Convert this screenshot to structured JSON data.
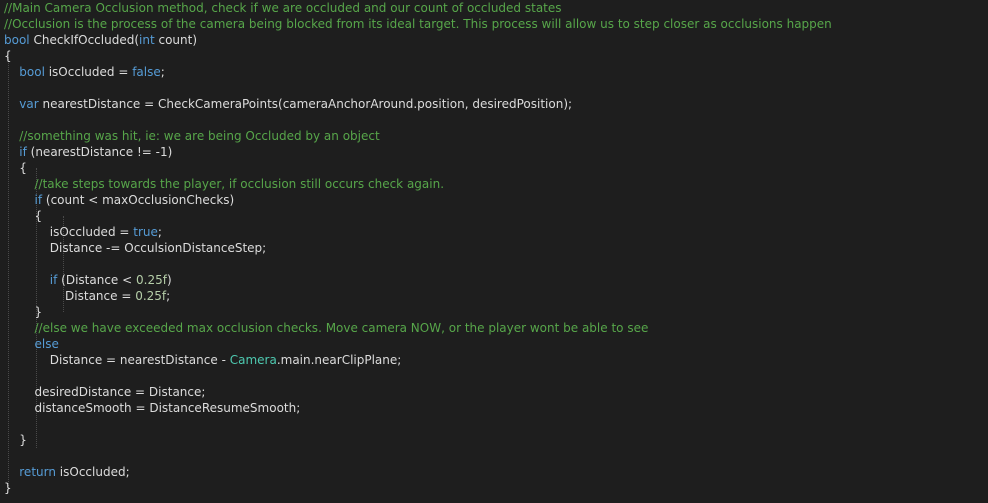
{
  "editor": {
    "language": "csharp",
    "colors": {
      "background": "#1e1e1e",
      "keyword": "#569cd6",
      "comment": "#57a64a",
      "number": "#b5cea8",
      "type": "#4ec9b0",
      "text": "#dcdcdc"
    },
    "lines": [
      [
        [
          "cm",
          "//Main Camera Occlusion method, check if we are occluded and our count of occluded states"
        ]
      ],
      [
        [
          "cm",
          "//Occlusion is the process of the camera being blocked from its ideal target. This process will allow us to step closer as occlusions happen"
        ]
      ],
      [
        [
          "kw",
          "bool"
        ],
        [
          "tx",
          " CheckIfOccluded("
        ],
        [
          "kw",
          "int"
        ],
        [
          "tx",
          " count)"
        ]
      ],
      [
        [
          "tx",
          "{"
        ]
      ],
      [
        [
          "tx",
          "    "
        ],
        [
          "kw",
          "bool"
        ],
        [
          "tx",
          " isOccluded = "
        ],
        [
          "kw",
          "false"
        ],
        [
          "tx",
          ";"
        ]
      ],
      [
        [
          "tx",
          ""
        ]
      ],
      [
        [
          "tx",
          "    "
        ],
        [
          "kw",
          "var"
        ],
        [
          "tx",
          " nearestDistance = CheckCameraPoints(cameraAnchorAround.position, desiredPosition);"
        ]
      ],
      [
        [
          "tx",
          ""
        ]
      ],
      [
        [
          "tx",
          "    "
        ],
        [
          "cm",
          "//something was hit, ie: we are being Occluded by an object"
        ]
      ],
      [
        [
          "tx",
          "    "
        ],
        [
          "kw",
          "if"
        ],
        [
          "tx",
          " (nearestDistance != -1)"
        ]
      ],
      [
        [
          "tx",
          "    {"
        ]
      ],
      [
        [
          "tx",
          "        "
        ],
        [
          "cm",
          "//take steps towards the player, if occlusion still occurs check again."
        ]
      ],
      [
        [
          "tx",
          "        "
        ],
        [
          "kw",
          "if"
        ],
        [
          "tx",
          " (count < maxOcclusionChecks)"
        ]
      ],
      [
        [
          "tx",
          "        {"
        ]
      ],
      [
        [
          "tx",
          "            isOccluded = "
        ],
        [
          "kw",
          "true"
        ],
        [
          "tx",
          ";"
        ]
      ],
      [
        [
          "tx",
          "            Distance -= OcculsionDistanceStep;"
        ]
      ],
      [
        [
          "tx",
          ""
        ]
      ],
      [
        [
          "tx",
          "            "
        ],
        [
          "kw",
          "if"
        ],
        [
          "tx",
          " (Distance < "
        ],
        [
          "nm",
          "0.25f"
        ],
        [
          "tx",
          ")"
        ]
      ],
      [
        [
          "tx",
          "                Distance = "
        ],
        [
          "nm",
          "0.25f"
        ],
        [
          "tx",
          ";"
        ]
      ],
      [
        [
          "tx",
          "        }"
        ]
      ],
      [
        [
          "tx",
          "        "
        ],
        [
          "cm",
          "//else we have exceeded max occlusion checks. Move camera NOW, or the player wont be able to see"
        ]
      ],
      [
        [
          "tx",
          "        "
        ],
        [
          "kw",
          "else"
        ]
      ],
      [
        [
          "tx",
          "            Distance = nearestDistance - "
        ],
        [
          "ty",
          "Camera"
        ],
        [
          "tx",
          ".main.nearClipPlane;"
        ]
      ],
      [
        [
          "tx",
          ""
        ]
      ],
      [
        [
          "tx",
          "        desiredDistance = Distance;"
        ]
      ],
      [
        [
          "tx",
          "        distanceSmooth = DistanceResumeSmooth;"
        ]
      ],
      [
        [
          "tx",
          ""
        ]
      ],
      [
        [
          "tx",
          "    }"
        ]
      ],
      [
        [
          "tx",
          ""
        ]
      ],
      [
        [
          "tx",
          "    "
        ],
        [
          "kw",
          "return"
        ],
        [
          "tx",
          " isOccluded;"
        ]
      ],
      [
        [
          "tx",
          "}"
        ]
      ]
    ]
  }
}
